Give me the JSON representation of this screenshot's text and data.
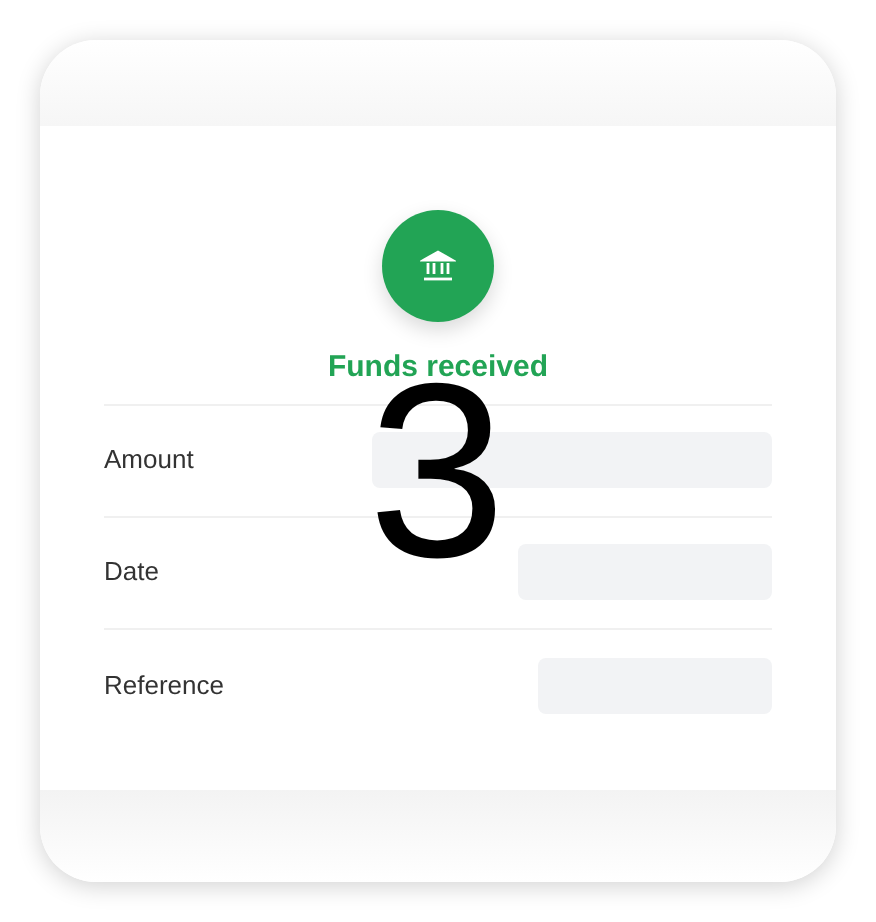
{
  "status": {
    "kind": "success",
    "title": "Funds received"
  },
  "rows": [
    {
      "label": "Amount",
      "loading": true
    },
    {
      "label": "Date",
      "loading": true
    },
    {
      "label": "Reference",
      "loading": true
    }
  ],
  "overlay_number": "3"
}
